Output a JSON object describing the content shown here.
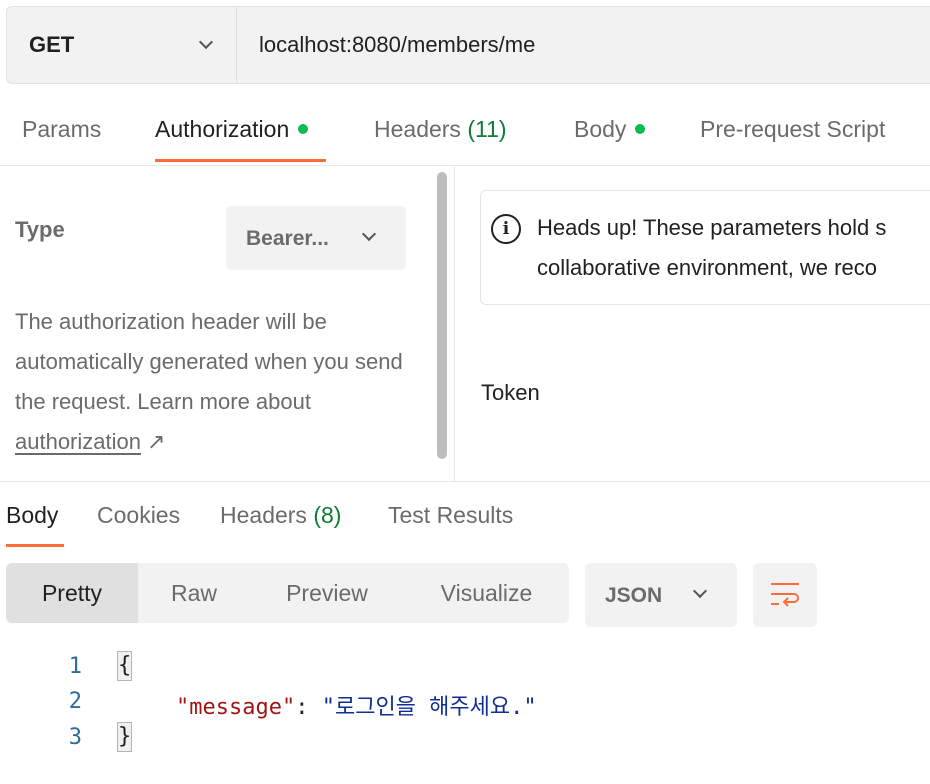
{
  "request": {
    "method": "GET",
    "url": "localhost:8080/members/me"
  },
  "request_tabs": {
    "params": "Params",
    "authorization": "Authorization",
    "headers": "Headers",
    "headers_count": "(11)",
    "body": "Body",
    "prerequest": "Pre-request Script"
  },
  "auth": {
    "type_label": "Type",
    "type_value": "Bearer...",
    "description": "The authorization header will be automatically generated when you send the request. Learn more about ",
    "link_text": "authorization",
    "link_arrow": "↗",
    "notice_line1": "Heads up! These parameters hold s",
    "notice_line2": "collaborative environment, we reco",
    "token_label": "Token"
  },
  "response_tabs": {
    "body": "Body",
    "cookies": "Cookies",
    "headers": "Headers",
    "headers_count": "(8)",
    "test_results": "Test Results"
  },
  "view_modes": [
    "Pretty",
    "Raw",
    "Preview",
    "Visualize"
  ],
  "format": "JSON",
  "code": {
    "line_numbers": [
      "1",
      "2",
      "3"
    ],
    "open_brace": "{",
    "close_brace": "}",
    "key": "\"message\"",
    "colon": ": ",
    "value": "\"로그인을 해주세요.\""
  },
  "colors": {
    "accent": "#ff6c37",
    "status_dot": "#0cbb52",
    "count_green": "#0f7b34",
    "json_key": "#a31515",
    "json_string": "#0f2f93"
  }
}
